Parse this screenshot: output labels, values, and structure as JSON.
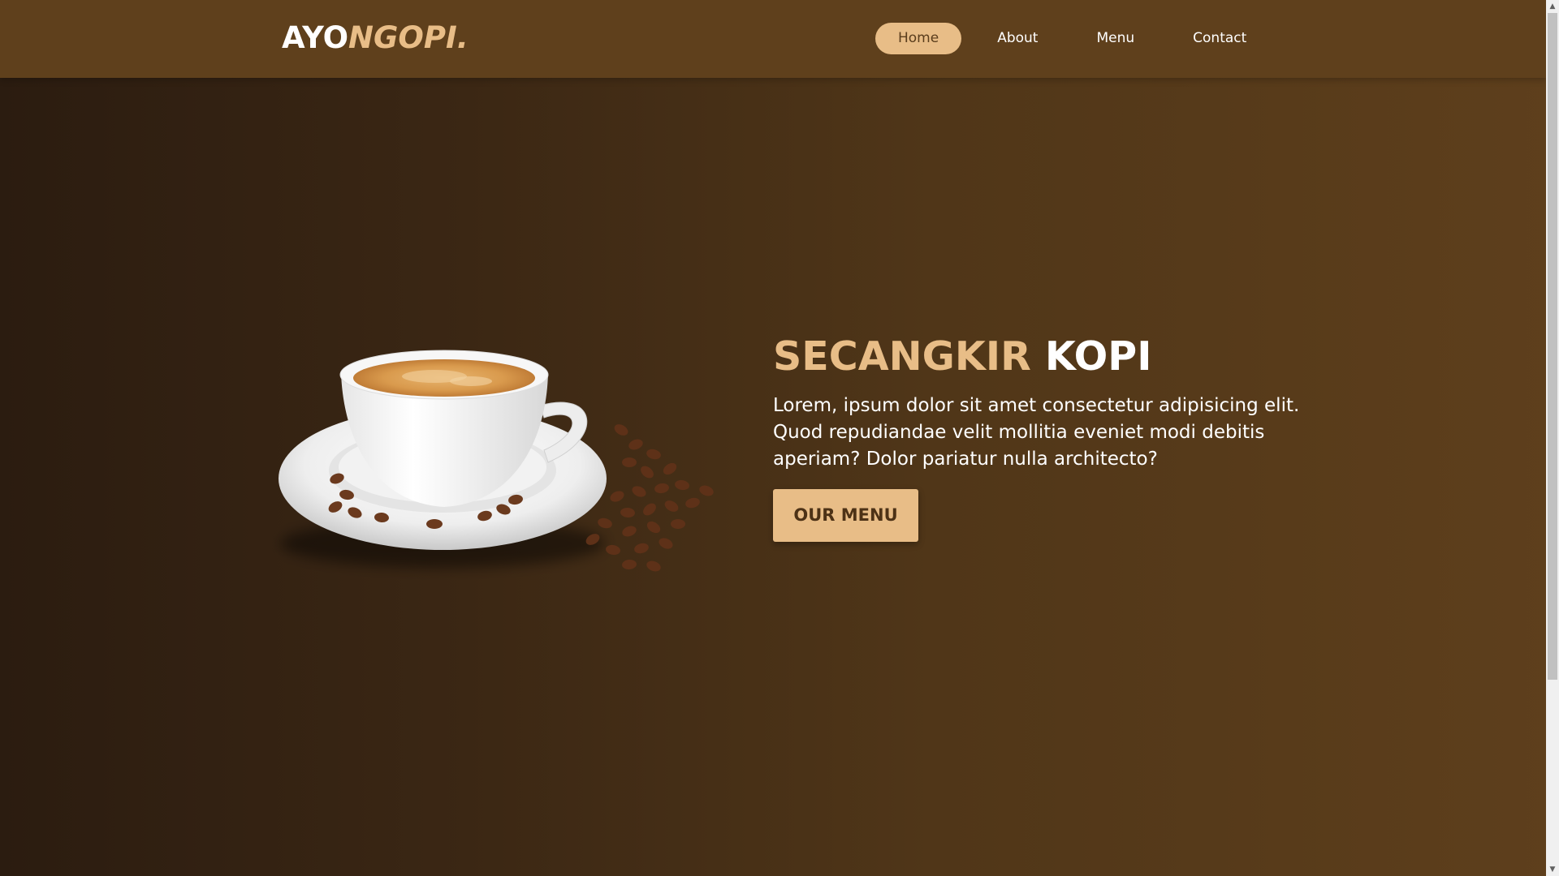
{
  "logo": {
    "part1": "AYO",
    "part2": "NGOPI."
  },
  "nav": {
    "items": [
      {
        "label": "Home",
        "active": true
      },
      {
        "label": "About",
        "active": false
      },
      {
        "label": "Menu",
        "active": false
      },
      {
        "label": "Contact",
        "active": false
      }
    ]
  },
  "hero": {
    "title_highlight": "SECANGKIR",
    "title_rest": "KOPI",
    "description": "Lorem, ipsum dolor sit amet consectetur adipisicing elit. Quod repudiandae velit mollitia eveniet modi debitis aperiam? Dolor pariatur nulla architecto?",
    "button_label": "OUR MENU",
    "image_icon": "coffee-cup-icon"
  },
  "colors": {
    "accent": "#e8bd87",
    "navbar": "#5f401c",
    "background_dark": "#2b1c10",
    "background_light": "#5e3f1c"
  }
}
